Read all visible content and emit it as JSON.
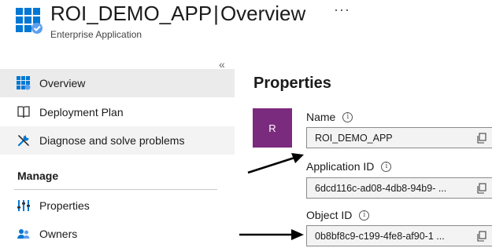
{
  "header": {
    "app_name": "ROI_DEMO_APP",
    "separator": "|",
    "page": "Overview",
    "subtitle": "Enterprise Application",
    "more": "···",
    "app_icon": "enterprise-app-grid-icon"
  },
  "sidebar": {
    "collapse": "«",
    "items": [
      {
        "label": "Overview",
        "icon": "overview-grid-icon",
        "state": "selected"
      },
      {
        "label": "Deployment Plan",
        "icon": "book-icon"
      },
      {
        "label": "Diagnose and solve problems",
        "icon": "wrench-icon",
        "state": "hover"
      }
    ],
    "manage_header": "Manage",
    "manage_items": [
      {
        "label": "Properties",
        "icon": "properties-sliders-icon"
      },
      {
        "label": "Owners",
        "icon": "owners-people-icon"
      }
    ]
  },
  "properties": {
    "title": "Properties",
    "avatar_letter": "R",
    "avatar_color": "#7b2b7e",
    "fields": [
      {
        "label": "Name",
        "value": "ROI_DEMO_APP"
      },
      {
        "label": "Application ID",
        "value": "6dcd116c-ad08-4db8-94b9- ..."
      },
      {
        "label": "Object ID",
        "value": "0b8bf8c9-c199-4fe8-af90-1 ..."
      }
    ]
  },
  "colors": {
    "accent": "#0078d4",
    "selected_bg": "#ebebeb"
  }
}
